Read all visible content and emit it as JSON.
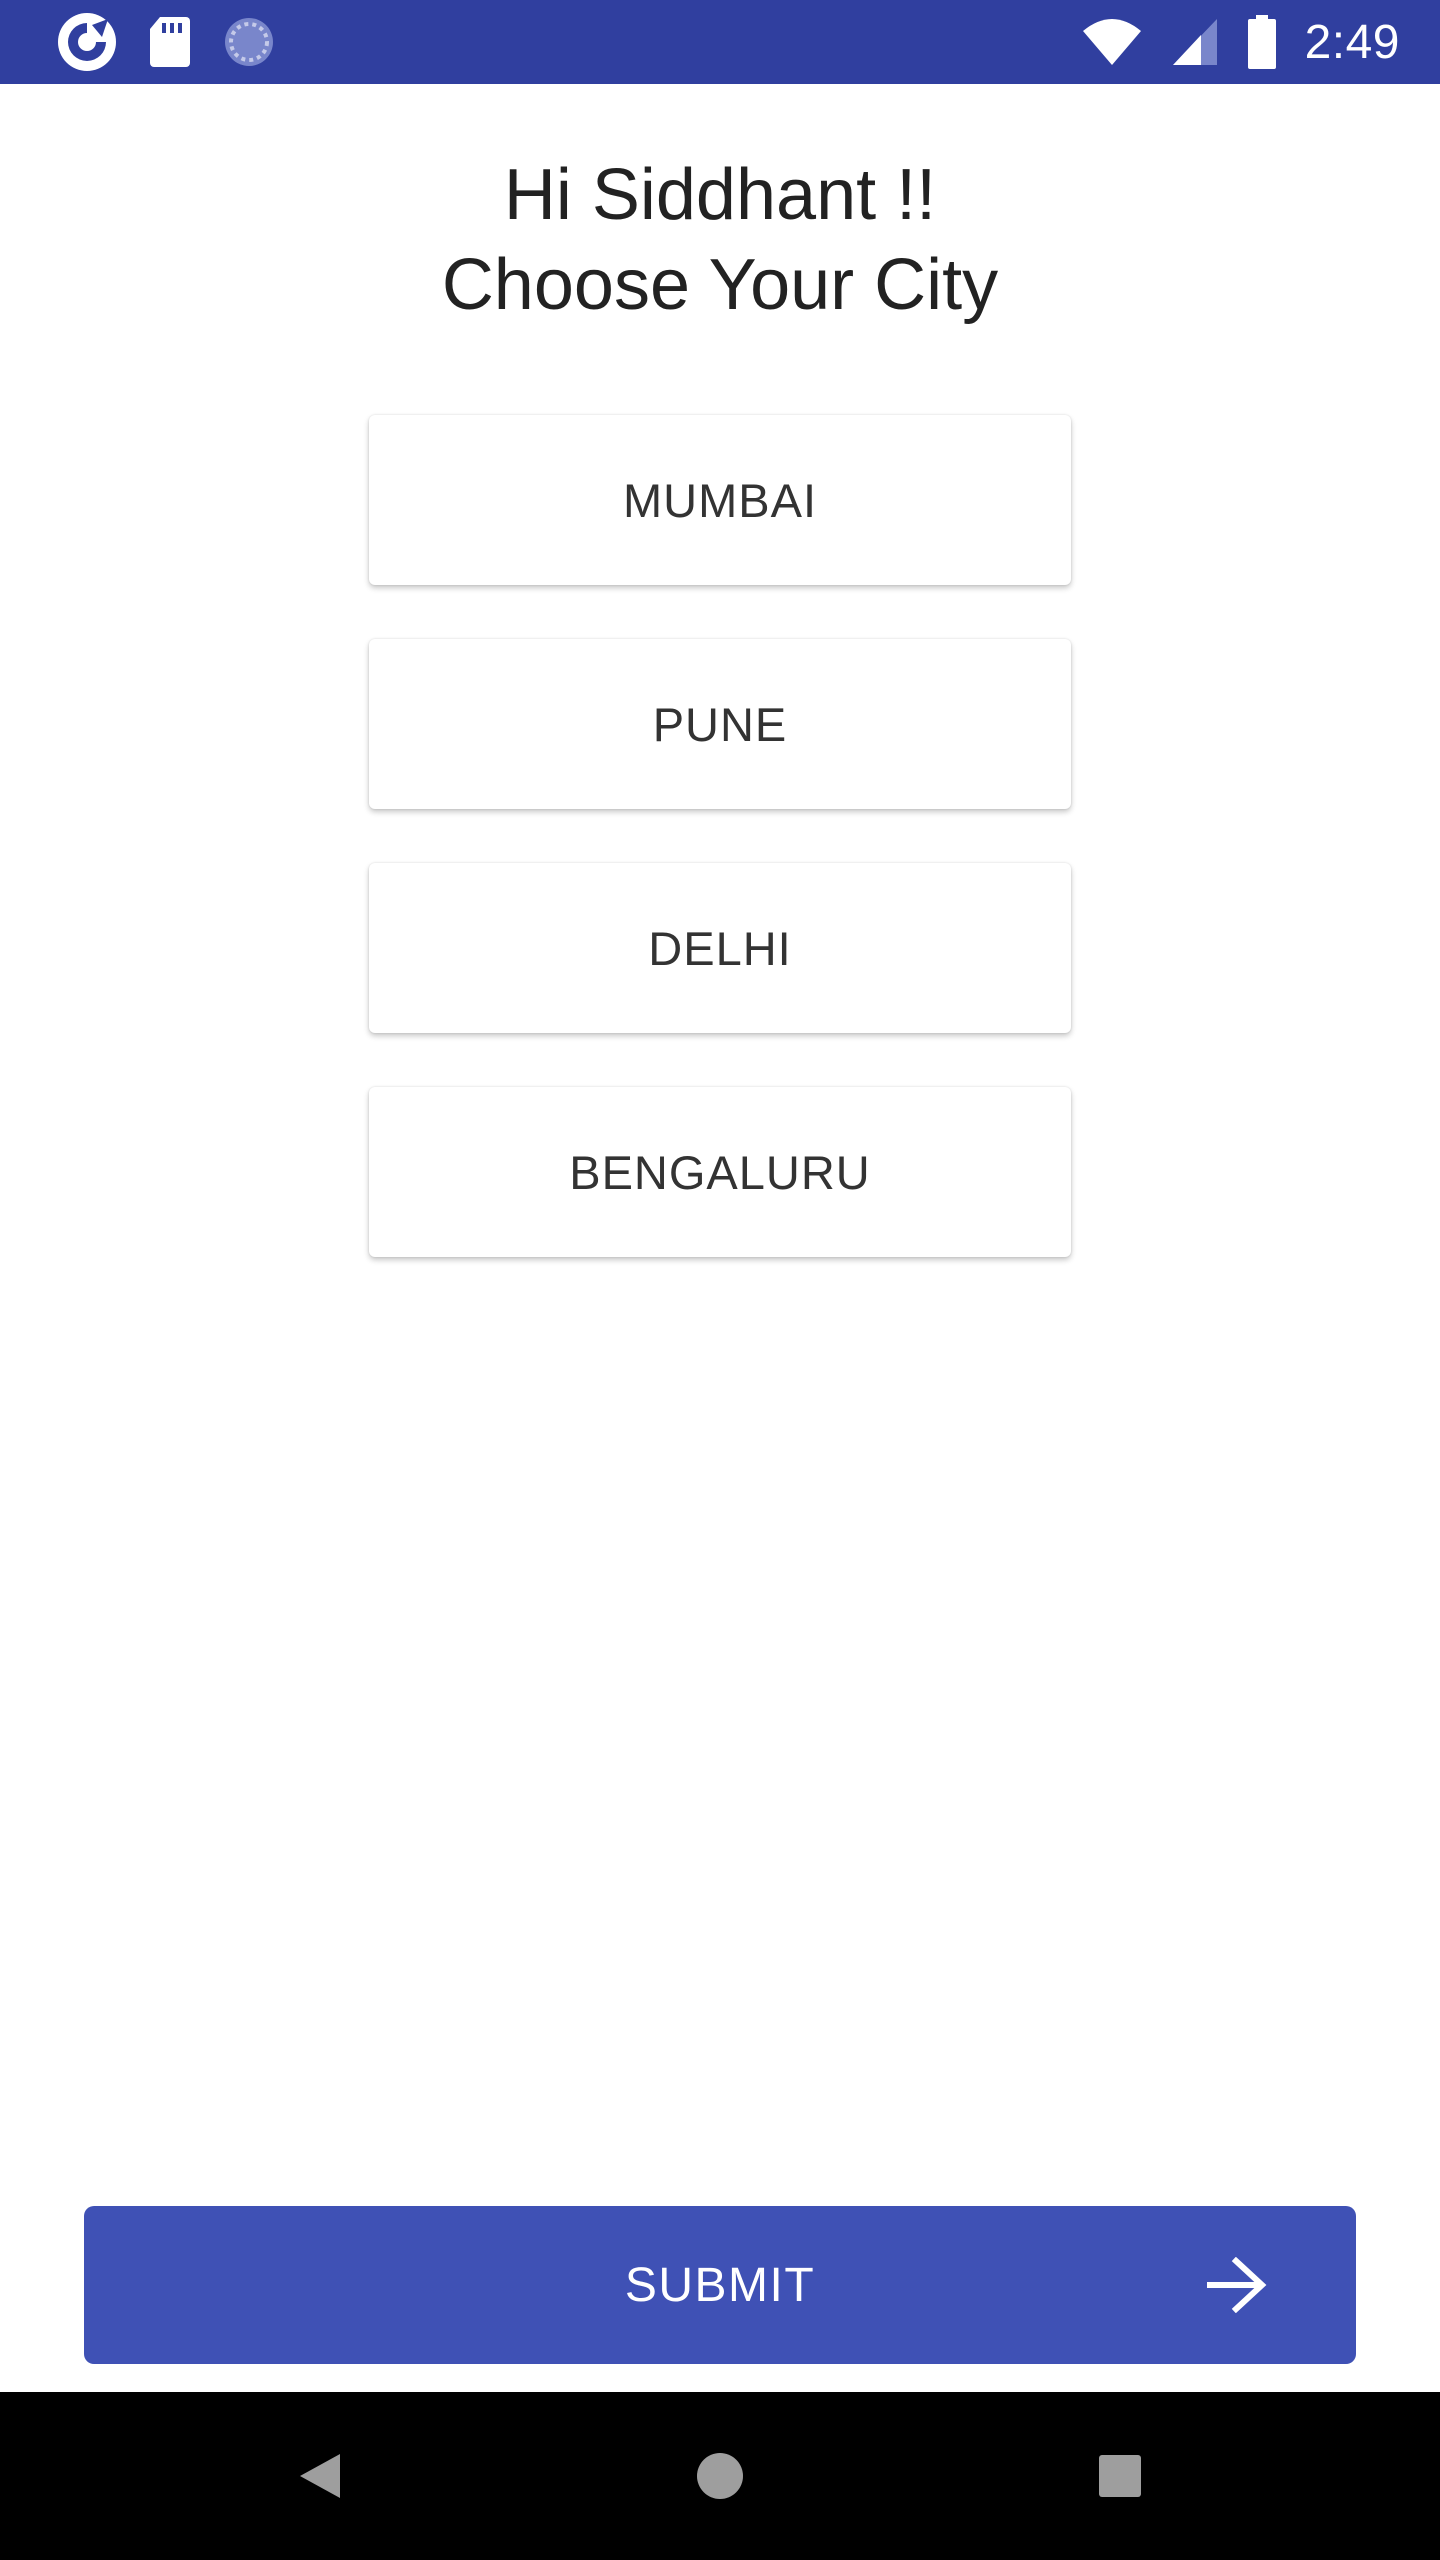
{
  "status_bar": {
    "time": "2:49",
    "left_icons": [
      "app-notification-icon",
      "sd-card-icon",
      "sync-icon"
    ],
    "right_icons": [
      "wifi-icon",
      "cell-signal-icon",
      "battery-icon"
    ],
    "background": "#303f9f"
  },
  "greeting": {
    "line1": "Hi Siddhant !!",
    "line2": "Choose Your City"
  },
  "cities": [
    {
      "label": "MUMBAI"
    },
    {
      "label": "PUNE"
    },
    {
      "label": "DELHI"
    },
    {
      "label": "BENGALURU"
    }
  ],
  "submit": {
    "label": "SUBMIT",
    "icon": "arrow-right-icon",
    "color": "#3f51b5"
  },
  "navigation": {
    "buttons": [
      "back-icon",
      "home-icon",
      "recents-icon"
    ]
  }
}
